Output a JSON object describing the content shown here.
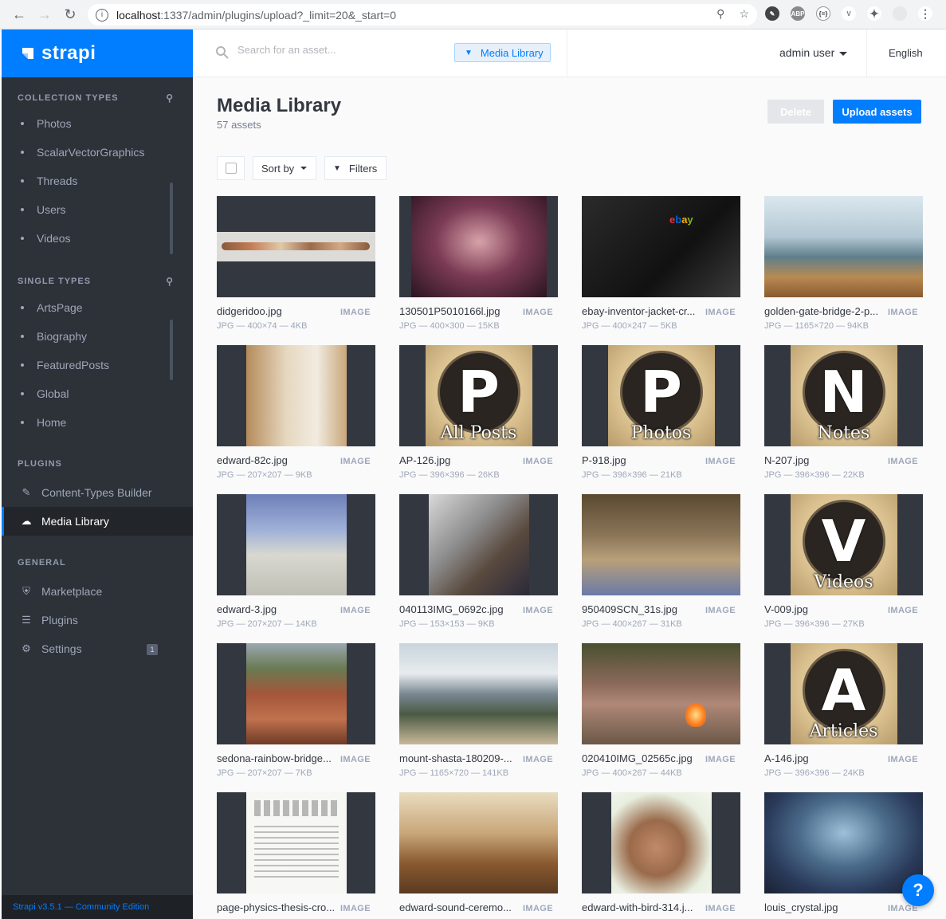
{
  "browser": {
    "url_host": "localhost",
    "url_path": ":1337/admin/plugins/upload?_limit=20&_start=0"
  },
  "brand": {
    "name": "strapi"
  },
  "sidebar": {
    "collection_title": "COLLECTION TYPES",
    "collection_items": [
      "Photos",
      "ScalarVectorGraphics",
      "Threads",
      "Users",
      "Videos"
    ],
    "single_title": "SINGLE TYPES",
    "single_items": [
      "ArtsPage",
      "Biography",
      "FeaturedPosts",
      "Global",
      "Home"
    ],
    "plugins_title": "PLUGINS",
    "plugin_items": [
      "Content-Types Builder",
      "Media Library"
    ],
    "general_title": "GENERAL",
    "general_items": [
      "Marketplace",
      "Plugins",
      "Settings"
    ],
    "settings_badge": "1",
    "footer": "Strapi v3.5.1 — Community Edition"
  },
  "header": {
    "search_placeholder": "Search for an asset...",
    "library_tag": "Media Library",
    "user": "admin user",
    "language": "English"
  },
  "main": {
    "title": "Media Library",
    "subtitle": "57 assets",
    "delete_label": "Delete",
    "upload_label": "Upload assets",
    "sort_label": "Sort by",
    "filters_label": "Filters"
  },
  "assets": [
    {
      "name": "didgeridoo.jpg",
      "type": "IMAGE",
      "info": "JPG — 400×74 — 4KB"
    },
    {
      "name": "130501P5010166l.jpg",
      "type": "IMAGE",
      "info": "JPG — 400×300 — 15KB"
    },
    {
      "name": "ebay-inventor-jacket-cr...",
      "type": "IMAGE",
      "info": "JPG — 400×247 — 5KB"
    },
    {
      "name": "golden-gate-bridge-2-p...",
      "type": "IMAGE",
      "info": "JPG — 1165×720 — 94KB"
    },
    {
      "name": "edward-82c.jpg",
      "type": "IMAGE",
      "info": "JPG — 207×207 — 9KB"
    },
    {
      "name": "AP-126.jpg",
      "type": "IMAGE",
      "info": "JPG — 396×396 — 26KB"
    },
    {
      "name": "P-918.jpg",
      "type": "IMAGE",
      "info": "JPG — 396×396 — 21KB"
    },
    {
      "name": "N-207.jpg",
      "type": "IMAGE",
      "info": "JPG — 396×396 — 22KB"
    },
    {
      "name": "edward-3.jpg",
      "type": "IMAGE",
      "info": "JPG — 207×207 — 14KB"
    },
    {
      "name": "040113IMG_0692c.jpg",
      "type": "IMAGE",
      "info": "JPG — 153×153 — 9KB"
    },
    {
      "name": "950409SCN_31s.jpg",
      "type": "IMAGE",
      "info": "JPG — 400×267 — 31KB"
    },
    {
      "name": "V-009.jpg",
      "type": "IMAGE",
      "info": "JPG — 396×396 — 27KB"
    },
    {
      "name": "sedona-rainbow-bridge...",
      "type": "IMAGE",
      "info": "JPG — 207×207 — 7KB"
    },
    {
      "name": "mount-shasta-180209-...",
      "type": "IMAGE",
      "info": "JPG — 1165×720 — 141KB"
    },
    {
      "name": "020410IMG_02565c.jpg",
      "type": "IMAGE",
      "info": "JPG — 400×267 — 44KB"
    },
    {
      "name": "A-146.jpg",
      "type": "IMAGE",
      "info": "JPG — 396×396 — 24KB"
    },
    {
      "name": "page-physics-thesis-cro...",
      "type": "IMAGE",
      "info": ""
    },
    {
      "name": "edward-sound-ceremo...",
      "type": "IMAGE",
      "info": ""
    },
    {
      "name": "edward-with-bird-314.j...",
      "type": "IMAGE",
      "info": ""
    },
    {
      "name": "louis_crystal.jpg",
      "type": "IMAGE",
      "info": ""
    }
  ],
  "monograms": {
    "ap": {
      "letter": "P",
      "word": "All Posts"
    },
    "p": {
      "letter": "P",
      "word": "Photos"
    },
    "n": {
      "letter": "N",
      "word": "Notes"
    },
    "v": {
      "letter": "V",
      "word": "Videos"
    },
    "a": {
      "letter": "A",
      "word": "Articles"
    }
  },
  "help_label": "?"
}
